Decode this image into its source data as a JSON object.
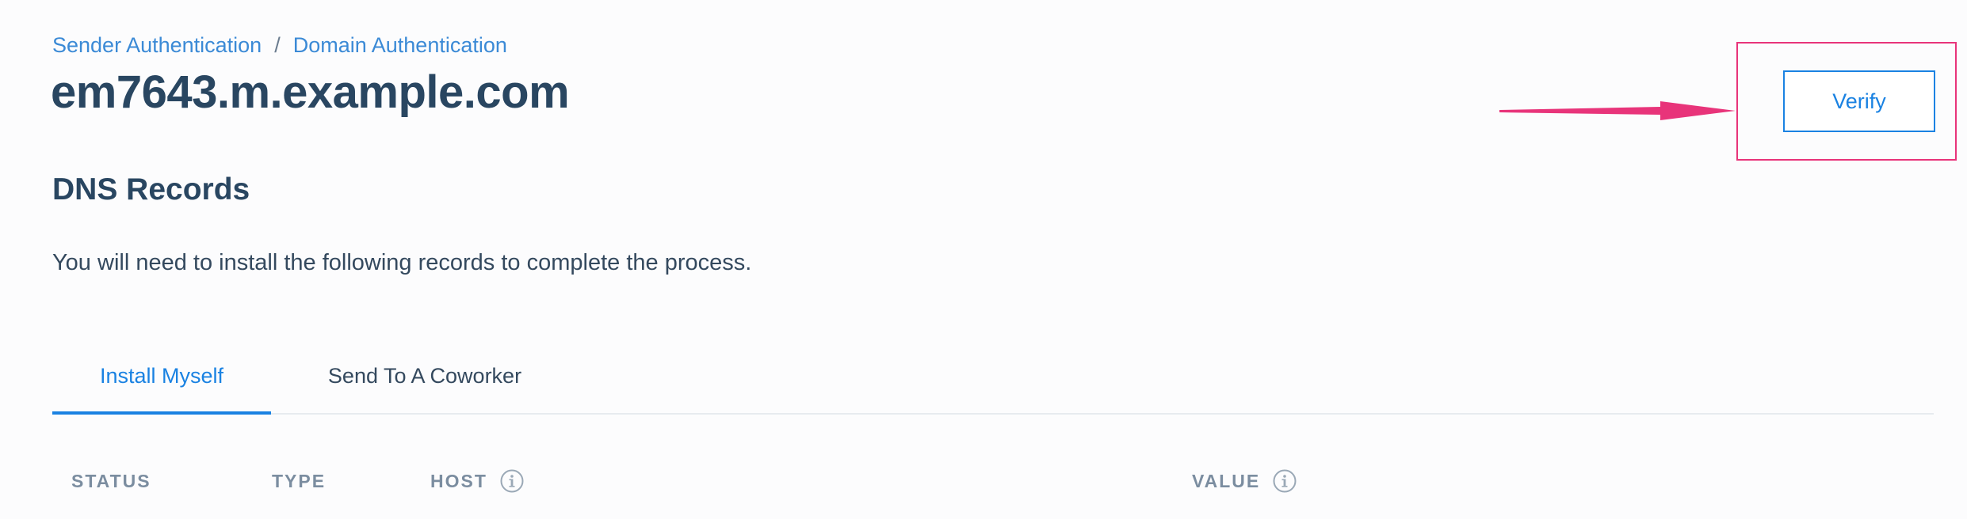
{
  "breadcrumb": {
    "items": [
      "Sender Authentication",
      "Domain Authentication"
    ],
    "separator": "/"
  },
  "page": {
    "title": "em7643.m.example.com"
  },
  "dns": {
    "section_title": "DNS Records",
    "intro": "You will need to install the following records to complete the process."
  },
  "tabs": [
    {
      "label": "Install Myself",
      "active": true
    },
    {
      "label": "Send To A Coworker",
      "active": false
    }
  ],
  "table": {
    "columns": [
      "STATUS",
      "TYPE",
      "HOST",
      "VALUE"
    ]
  },
  "actions": {
    "verify_label": "Verify"
  },
  "annotation": {
    "arrow_color": "#e8347a",
    "highlight_color": "#e8347a"
  },
  "colors": {
    "link": "#3b8ad6",
    "primary": "#1a82e2",
    "heading": "#294661",
    "muted": "#7b8da0"
  }
}
